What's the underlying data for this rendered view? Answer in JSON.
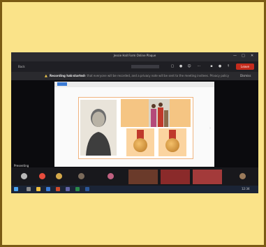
{
  "window": {
    "title": "Jessie Hall Form Online Plaque",
    "controls": [
      "—",
      "□",
      "✕"
    ]
  },
  "toolbar": {
    "back_label": "Back",
    "leave_label": "Leave"
  },
  "banner": {
    "title": "Recording has started",
    "message": "Please note that everyone will be recorded, and a privacy note will be sent to the meeting invitees. Privacy policy",
    "dismiss": "Dismiss"
  },
  "participant_label": "Presenting",
  "taskbar": {
    "time": "12:34"
  },
  "colors": {
    "frame": "#fae389",
    "leave": "#c42b1c"
  }
}
